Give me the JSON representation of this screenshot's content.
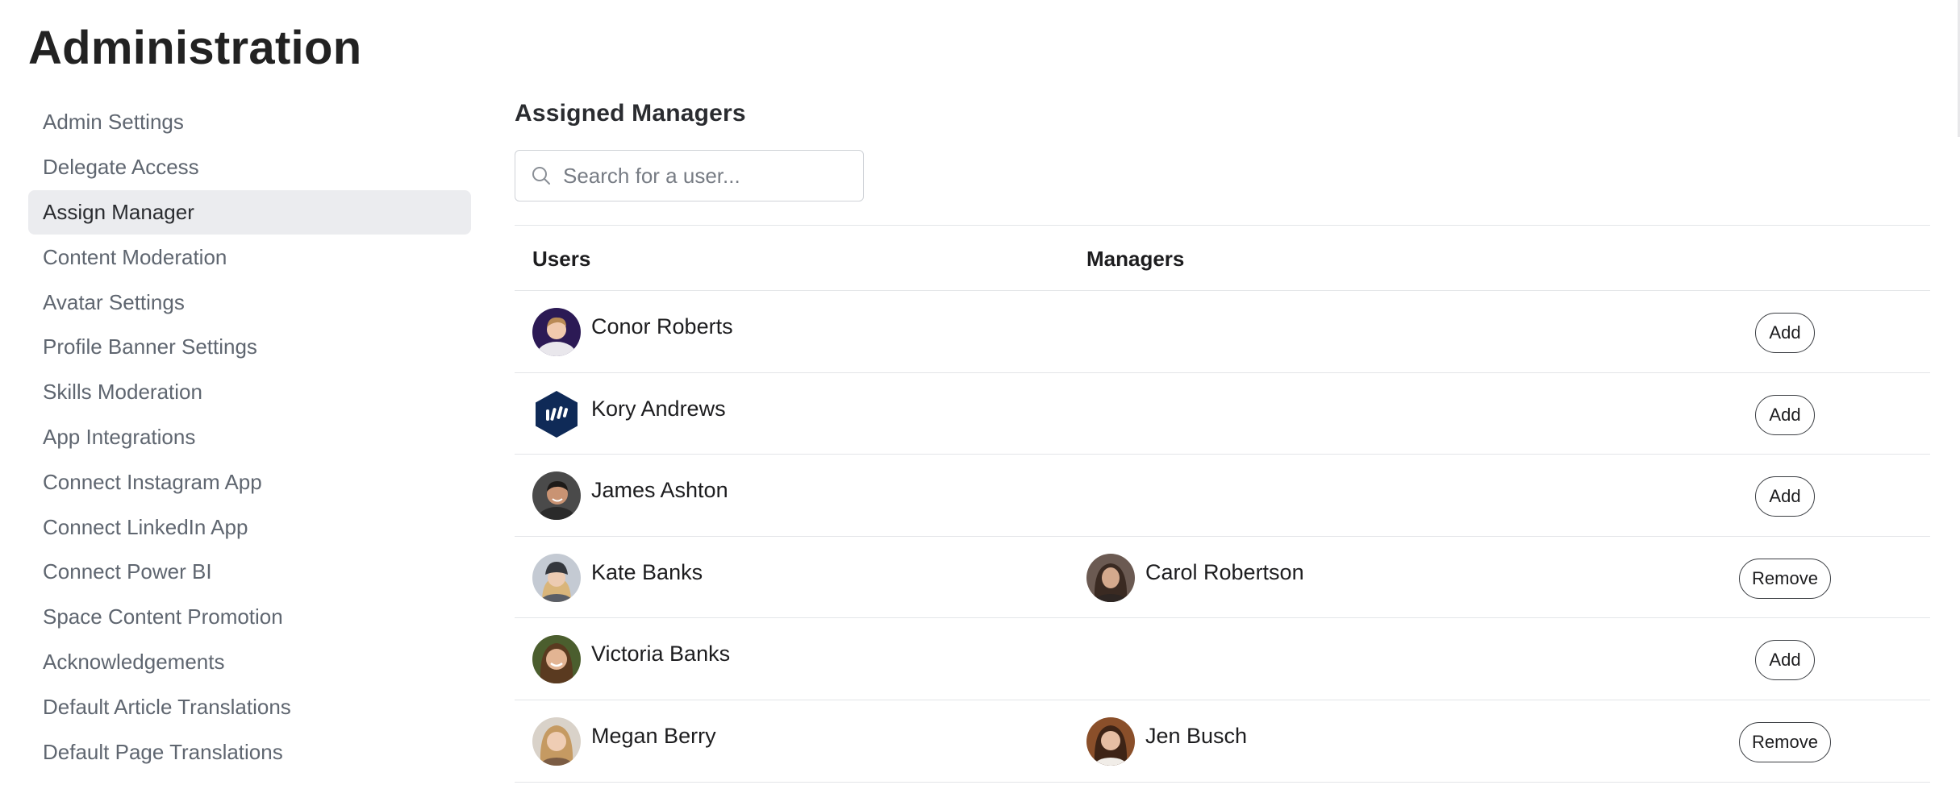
{
  "page_title": "Administration",
  "sidebar": {
    "items": [
      {
        "label": "Admin Settings",
        "active": false
      },
      {
        "label": "Delegate Access",
        "active": false
      },
      {
        "label": "Assign Manager",
        "active": true
      },
      {
        "label": "Content Moderation",
        "active": false
      },
      {
        "label": "Avatar Settings",
        "active": false
      },
      {
        "label": "Profile Banner Settings",
        "active": false
      },
      {
        "label": "Skills Moderation",
        "active": false
      },
      {
        "label": "App Integrations",
        "active": false
      },
      {
        "label": "Connect Instagram App",
        "active": false
      },
      {
        "label": "Connect LinkedIn App",
        "active": false
      },
      {
        "label": "Connect Power BI",
        "active": false
      },
      {
        "label": "Space Content Promotion",
        "active": false
      },
      {
        "label": "Acknowledgements",
        "active": false
      },
      {
        "label": "Default Article Translations",
        "active": false
      },
      {
        "label": "Default Page Translations",
        "active": false
      }
    ]
  },
  "main": {
    "section_title": "Assigned Managers",
    "search": {
      "placeholder": "Search for a user...",
      "value": "",
      "icon": "search-icon"
    },
    "table": {
      "headers": {
        "users": "Users",
        "managers": "Managers"
      },
      "rows": [
        {
          "user": "Conor Roberts",
          "manager": "",
          "action": "Add"
        },
        {
          "user": "Kory Andrews",
          "manager": "",
          "action": "Add"
        },
        {
          "user": "James Ashton",
          "manager": "",
          "action": "Add"
        },
        {
          "user": "Kate Banks",
          "manager": "Carol Robertson",
          "action": "Remove"
        },
        {
          "user": "Victoria Banks",
          "manager": "",
          "action": "Add"
        },
        {
          "user": "Megan Berry",
          "manager": "Jen Busch",
          "action": "Remove"
        }
      ]
    }
  },
  "colors": {
    "active_nav_bg": "#ebecef",
    "nav_text": "#5f6670",
    "divider": "#e3e5e8",
    "button_border": "#3a3d42"
  }
}
